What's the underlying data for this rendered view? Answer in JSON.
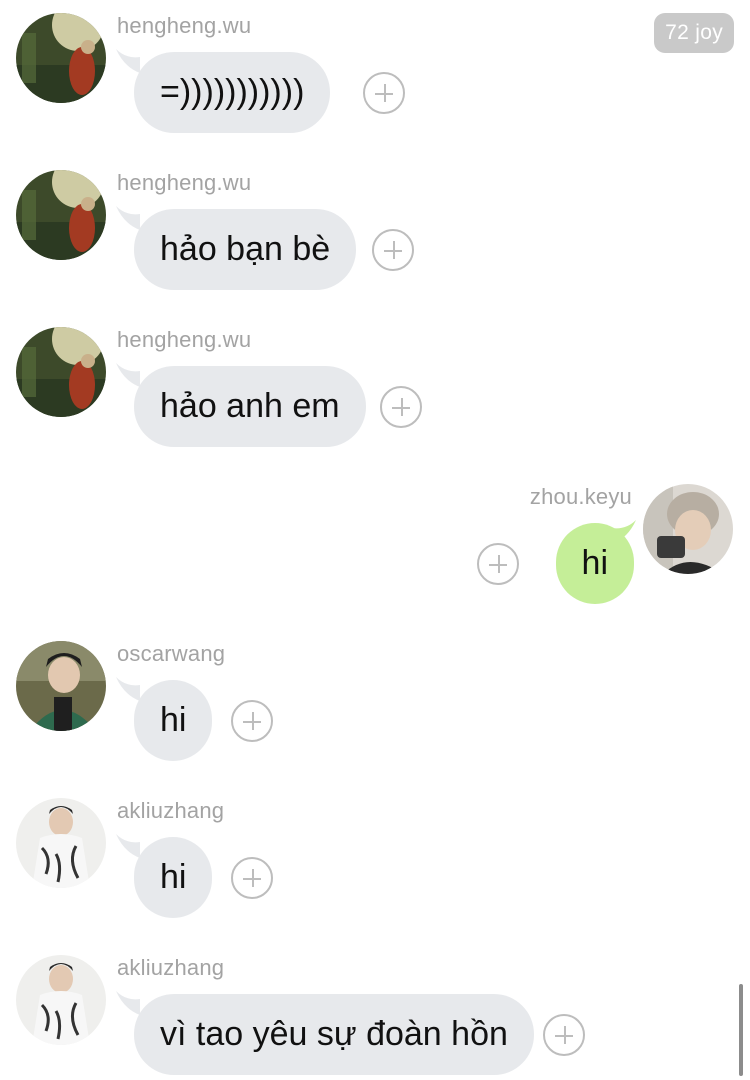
{
  "header": {
    "badge": "72 joy"
  },
  "messages": [
    {
      "side": "left",
      "user": "hengheng.wu",
      "text": "=)))))))))))",
      "avatar": "hengheng-avatar-icon"
    },
    {
      "side": "left",
      "user": "hengheng.wu",
      "text": "hảo bạn bè",
      "avatar": "hengheng-avatar-icon"
    },
    {
      "side": "left",
      "user": "hengheng.wu",
      "text": "hảo anh em",
      "avatar": "hengheng-avatar-icon"
    },
    {
      "side": "right",
      "user": "zhou.keyu",
      "text": "hi",
      "avatar": "zhoukeyu-avatar-icon"
    },
    {
      "side": "left",
      "user": "oscarwang",
      "text": "hi",
      "avatar": "oscarwang-avatar-icon"
    },
    {
      "side": "left",
      "user": "akliuzhang",
      "text": "hi",
      "avatar": "akliuzhang-avatar-icon"
    },
    {
      "side": "left",
      "user": "akliuzhang",
      "text": "vì tao yêu sự đoàn hồn",
      "avatar": "akliuzhang-avatar-icon"
    }
  ],
  "colors": {
    "incoming_bubble": "#e7e9ec",
    "outgoing_bubble": "#c5ee98",
    "username": "#a3a3a3",
    "badge_bg": "#c9c9c9"
  }
}
